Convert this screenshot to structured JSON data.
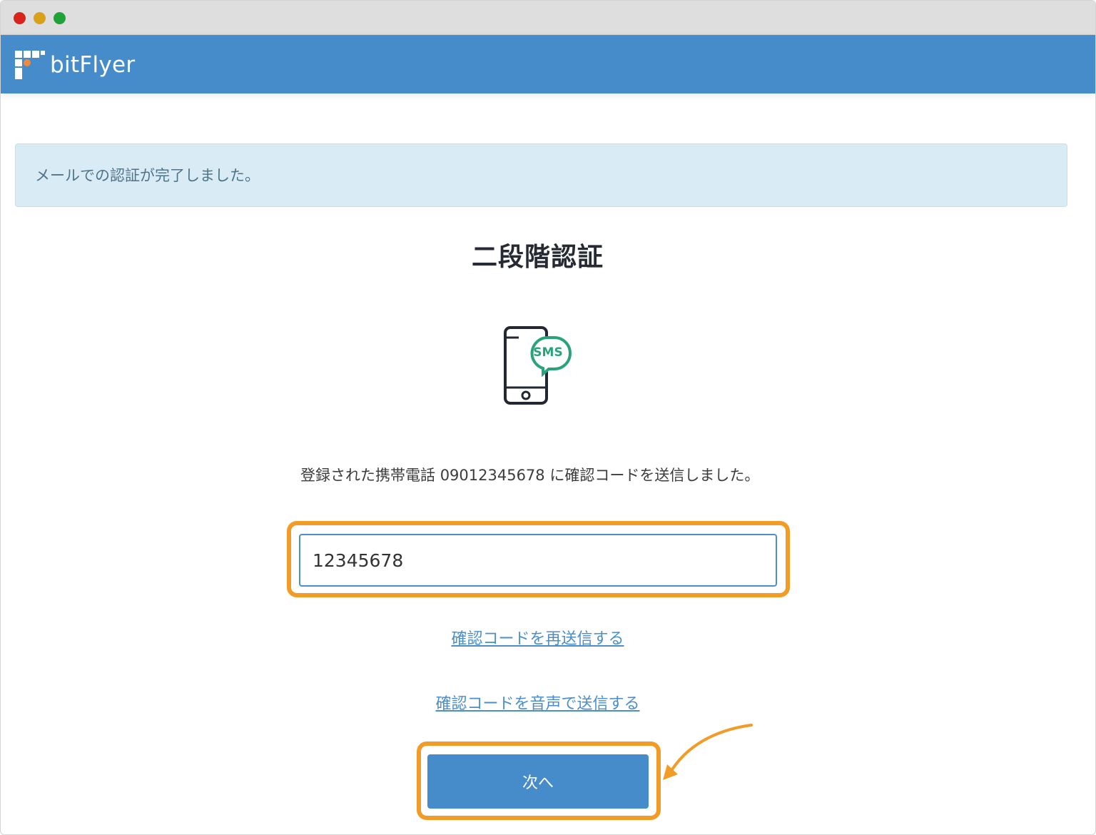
{
  "window": {
    "controls": [
      "close",
      "minimize",
      "zoom"
    ]
  },
  "header": {
    "brand": "bitFlyer",
    "logo_icon": "bitflyer-logo-icon",
    "bar_color": "#468ccb",
    "accent_color": "#f08a3a"
  },
  "alert": {
    "message": "メールでの認証が完了しました。"
  },
  "page": {
    "title": "二段階認証",
    "icon": "phone-sms-icon",
    "description_prefix": "登録された携帯電話 ",
    "phone_number": "09012345678",
    "description_suffix": " に確認コードを送信しました。"
  },
  "form": {
    "code_value": "12345678",
    "resend_link": "確認コードを再送信する",
    "voice_link": "確認コードを音声で送信する",
    "next_button": "次へ"
  },
  "annotations": {
    "highlight_color": "#f29b26"
  }
}
